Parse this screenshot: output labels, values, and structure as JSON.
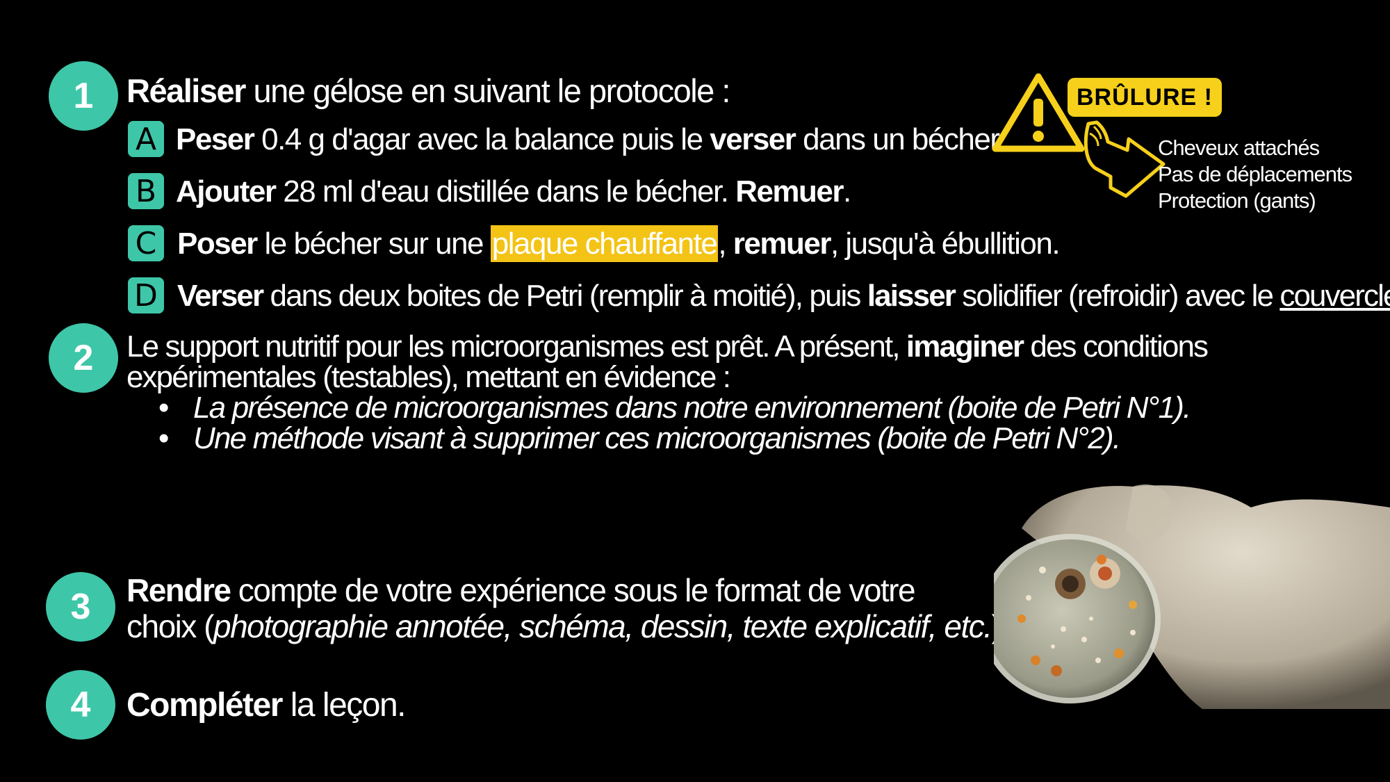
{
  "colors": {
    "accent": "#3ec6a8",
    "highlight": "#f3c316",
    "warning": "#f6d01b",
    "background": "#000000"
  },
  "steps": [
    {
      "number": "1",
      "verb": "Réaliser",
      "rest": " une gélose en suivant le protocole :"
    },
    {
      "number": "2",
      "line1_a": "Le support nutritif pour les microorganismes est prêt. A présent, ",
      "line1_verb": "imaginer",
      "line1_b": " des conditions",
      "line2": "expérimentales (testables), mettant en évidence :"
    },
    {
      "number": "3",
      "verb": "Rendre",
      "line1_rest": " compte de votre expérience sous le format de votre",
      "line2_a": "choix (",
      "line2_italic": "photographie annotée, schéma, dessin, texte explicatif, etc.",
      "line2_b": ")"
    },
    {
      "number": "4",
      "verb": "Compléter",
      "rest": " la leçon."
    }
  ],
  "substeps": [
    {
      "letter": "A",
      "verb": "Peser",
      "t1": " 0.4 g d'agar avec la balance puis le ",
      "verb2": "verser",
      "t2": " dans un bécher."
    },
    {
      "letter": "B",
      "verb": "Ajouter",
      "t1": " 28 ml d'eau distillée dans le bécher. ",
      "verb2": "Remuer",
      "t2": "."
    },
    {
      "letter": "C",
      "verb": "Poser",
      "t1": " le bécher sur une ",
      "highlight": "plaque chauffante",
      "t2": ", ",
      "verb2": "remuer",
      "t3": ", jusqu'à ébullition."
    },
    {
      "letter": "D",
      "verb": "Verser",
      "t1": " dans deux boites de Petri (remplir à moitié), puis ",
      "verb2": "laisser",
      "t2": " solidifier (refroidir) avec le ",
      "underline": "couvercle",
      "t3": "."
    }
  ],
  "bullets": [
    "La présence de microorganismes dans notre environnement (boite de Petri N°1).",
    "Une méthode visant à supprimer ces microorganismes (boite de Petri N°2)."
  ],
  "warning": {
    "badge": "BRÛLURE !",
    "icon": "warning-triangle-icon",
    "items": [
      "Cheveux attachés",
      "Pas de déplacements",
      "Protection (gants)"
    ]
  }
}
